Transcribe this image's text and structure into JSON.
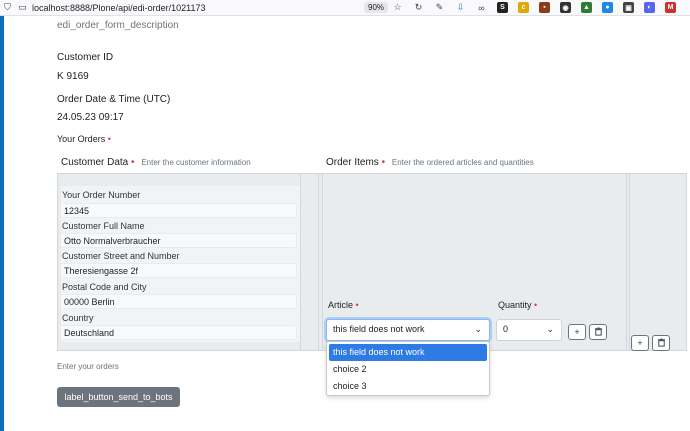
{
  "browser": {
    "url": "localhost:8888/Plone/api/edi-order/1021173",
    "zoom": "90%"
  },
  "form": {
    "description": "edi_order_form_description",
    "customer_id_label": "Customer ID",
    "customer_id_value": "K 9169",
    "order_date_label": "Order Date & Time (UTC)",
    "order_date_value": "24.05.23 09:17",
    "your_orders_label": "Your Orders",
    "required_marker": "•",
    "help_text": "Enter your orders",
    "send_button": "label_button_send_to_bots"
  },
  "customer_data": {
    "heading": "Customer Data",
    "hint": "Enter the customer information",
    "fields": [
      {
        "label": "Your Order Number",
        "value": "12345"
      },
      {
        "label": "Customer Full Name",
        "value": "Otto Normalverbraucher"
      },
      {
        "label": "Customer Street and Number",
        "value": "Theresiengasse 2f"
      },
      {
        "label": "Postal Code and City",
        "value": "00000 Berlin"
      },
      {
        "label": "Country",
        "value": "Deutschland"
      }
    ]
  },
  "order_items": {
    "heading": "Order Items",
    "hint": "Enter the ordered articles and quantities",
    "article_label": "Article",
    "quantity_label": "Quantity",
    "article_value": "this field does not work",
    "quantity_value": "0",
    "article_options": [
      "this field does not work",
      "choice 2",
      "choice 3"
    ],
    "add_symbol": "+",
    "chevron": "⌄"
  },
  "icons": {
    "add": "+",
    "delete": "trash-icon"
  }
}
